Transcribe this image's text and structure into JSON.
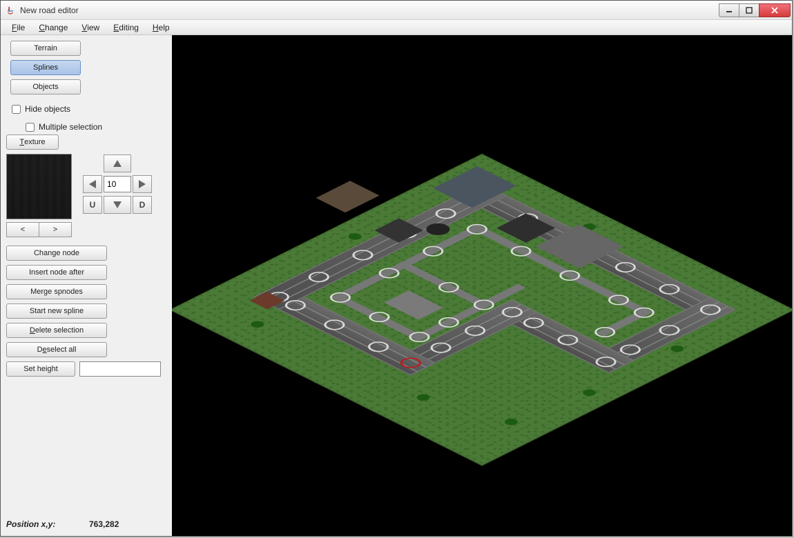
{
  "window": {
    "title": "New road editor"
  },
  "menubar": [
    "File",
    "Change",
    "View",
    "Editing",
    "Help"
  ],
  "sidebar": {
    "tabs": {
      "terrain": "Terrain",
      "splines": "Splines",
      "objects": "Objects"
    },
    "active_tab": "splines",
    "hide_objects_label": "Hide objects",
    "multiple_selection_label": "Multiple selection",
    "texture_label": "Texture",
    "nav": {
      "value": "10",
      "u_label": "U",
      "d_label": "D"
    },
    "pager": {
      "prev": "<",
      "next": ">"
    },
    "ops": {
      "change_node": "Change node",
      "insert_node_after": "Insert node after",
      "merge_spnodes": "Merge spnodes",
      "start_new_spline": "Start new spline",
      "delete_selection": "Delete selection",
      "deselect_all": "Deselect all",
      "set_height": "Set height"
    },
    "set_height_value": ""
  },
  "status": {
    "label": "Position x,y:",
    "value": "763,282"
  }
}
